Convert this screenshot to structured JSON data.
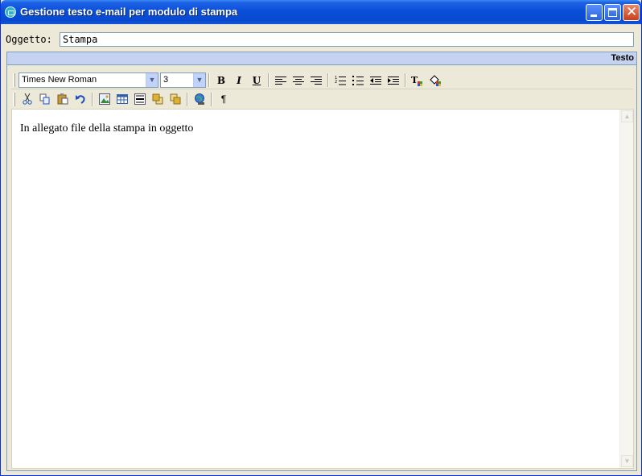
{
  "window": {
    "title": "Gestione testo e-mail per modulo di stampa"
  },
  "form": {
    "subject_label": "Oggetto:",
    "subject_value": "Stampa"
  },
  "panel": {
    "header": "Testo"
  },
  "toolbar": {
    "font_name": "Times New Roman",
    "font_size": "3",
    "bold_label": "B",
    "italic_label": "I",
    "underline_label": "U",
    "pilcrow_label": "¶",
    "icons": [
      "bold-icon",
      "italic-icon",
      "underline-icon",
      "align-left-icon",
      "align-center-icon",
      "align-right-icon",
      "ordered-list-icon",
      "unordered-list-icon",
      "outdent-icon",
      "indent-icon",
      "text-color-icon",
      "highlight-color-icon",
      "cut-icon",
      "copy-icon",
      "paste-icon",
      "undo-icon",
      "image-icon",
      "table-icon",
      "horizontal-rule-icon",
      "bring-forward-icon",
      "send-backward-icon",
      "link-icon",
      "pilcrow-icon"
    ]
  },
  "editor": {
    "content": "In allegato file della stampa in oggetto"
  }
}
